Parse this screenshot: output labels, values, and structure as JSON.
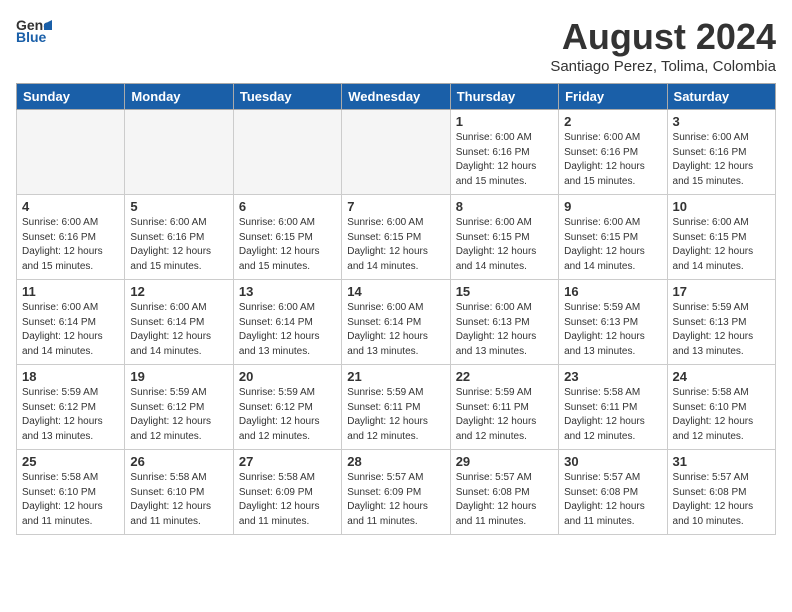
{
  "logo": {
    "general": "General",
    "blue": "Blue"
  },
  "title": {
    "month": "August 2024",
    "location": "Santiago Perez, Tolima, Colombia"
  },
  "weekdays": [
    "Sunday",
    "Monday",
    "Tuesday",
    "Wednesday",
    "Thursday",
    "Friday",
    "Saturday"
  ],
  "rows": [
    [
      {
        "day": "",
        "empty": true
      },
      {
        "day": "",
        "empty": true
      },
      {
        "day": "",
        "empty": true
      },
      {
        "day": "",
        "empty": true
      },
      {
        "day": "1",
        "sunrise": "6:00 AM",
        "sunset": "6:16 PM",
        "daylight": "12 hours and 15 minutes."
      },
      {
        "day": "2",
        "sunrise": "6:00 AM",
        "sunset": "6:16 PM",
        "daylight": "12 hours and 15 minutes."
      },
      {
        "day": "3",
        "sunrise": "6:00 AM",
        "sunset": "6:16 PM",
        "daylight": "12 hours and 15 minutes."
      }
    ],
    [
      {
        "day": "4",
        "sunrise": "6:00 AM",
        "sunset": "6:16 PM",
        "daylight": "12 hours and 15 minutes."
      },
      {
        "day": "5",
        "sunrise": "6:00 AM",
        "sunset": "6:16 PM",
        "daylight": "12 hours and 15 minutes."
      },
      {
        "day": "6",
        "sunrise": "6:00 AM",
        "sunset": "6:15 PM",
        "daylight": "12 hours and 15 minutes."
      },
      {
        "day": "7",
        "sunrise": "6:00 AM",
        "sunset": "6:15 PM",
        "daylight": "12 hours and 14 minutes."
      },
      {
        "day": "8",
        "sunrise": "6:00 AM",
        "sunset": "6:15 PM",
        "daylight": "12 hours and 14 minutes."
      },
      {
        "day": "9",
        "sunrise": "6:00 AM",
        "sunset": "6:15 PM",
        "daylight": "12 hours and 14 minutes."
      },
      {
        "day": "10",
        "sunrise": "6:00 AM",
        "sunset": "6:15 PM",
        "daylight": "12 hours and 14 minutes."
      }
    ],
    [
      {
        "day": "11",
        "sunrise": "6:00 AM",
        "sunset": "6:14 PM",
        "daylight": "12 hours and 14 minutes."
      },
      {
        "day": "12",
        "sunrise": "6:00 AM",
        "sunset": "6:14 PM",
        "daylight": "12 hours and 14 minutes."
      },
      {
        "day": "13",
        "sunrise": "6:00 AM",
        "sunset": "6:14 PM",
        "daylight": "12 hours and 13 minutes."
      },
      {
        "day": "14",
        "sunrise": "6:00 AM",
        "sunset": "6:14 PM",
        "daylight": "12 hours and 13 minutes."
      },
      {
        "day": "15",
        "sunrise": "6:00 AM",
        "sunset": "6:13 PM",
        "daylight": "12 hours and 13 minutes."
      },
      {
        "day": "16",
        "sunrise": "5:59 AM",
        "sunset": "6:13 PM",
        "daylight": "12 hours and 13 minutes."
      },
      {
        "day": "17",
        "sunrise": "5:59 AM",
        "sunset": "6:13 PM",
        "daylight": "12 hours and 13 minutes."
      }
    ],
    [
      {
        "day": "18",
        "sunrise": "5:59 AM",
        "sunset": "6:12 PM",
        "daylight": "12 hours and 13 minutes."
      },
      {
        "day": "19",
        "sunrise": "5:59 AM",
        "sunset": "6:12 PM",
        "daylight": "12 hours and 12 minutes."
      },
      {
        "day": "20",
        "sunrise": "5:59 AM",
        "sunset": "6:12 PM",
        "daylight": "12 hours and 12 minutes."
      },
      {
        "day": "21",
        "sunrise": "5:59 AM",
        "sunset": "6:11 PM",
        "daylight": "12 hours and 12 minutes."
      },
      {
        "day": "22",
        "sunrise": "5:59 AM",
        "sunset": "6:11 PM",
        "daylight": "12 hours and 12 minutes."
      },
      {
        "day": "23",
        "sunrise": "5:58 AM",
        "sunset": "6:11 PM",
        "daylight": "12 hours and 12 minutes."
      },
      {
        "day": "24",
        "sunrise": "5:58 AM",
        "sunset": "6:10 PM",
        "daylight": "12 hours and 12 minutes."
      }
    ],
    [
      {
        "day": "25",
        "sunrise": "5:58 AM",
        "sunset": "6:10 PM",
        "daylight": "12 hours and 11 minutes."
      },
      {
        "day": "26",
        "sunrise": "5:58 AM",
        "sunset": "6:10 PM",
        "daylight": "12 hours and 11 minutes."
      },
      {
        "day": "27",
        "sunrise": "5:58 AM",
        "sunset": "6:09 PM",
        "daylight": "12 hours and 11 minutes."
      },
      {
        "day": "28",
        "sunrise": "5:57 AM",
        "sunset": "6:09 PM",
        "daylight": "12 hours and 11 minutes."
      },
      {
        "day": "29",
        "sunrise": "5:57 AM",
        "sunset": "6:08 PM",
        "daylight": "12 hours and 11 minutes."
      },
      {
        "day": "30",
        "sunrise": "5:57 AM",
        "sunset": "6:08 PM",
        "daylight": "12 hours and 11 minutes."
      },
      {
        "day": "31",
        "sunrise": "5:57 AM",
        "sunset": "6:08 PM",
        "daylight": "12 hours and 10 minutes."
      }
    ]
  ]
}
